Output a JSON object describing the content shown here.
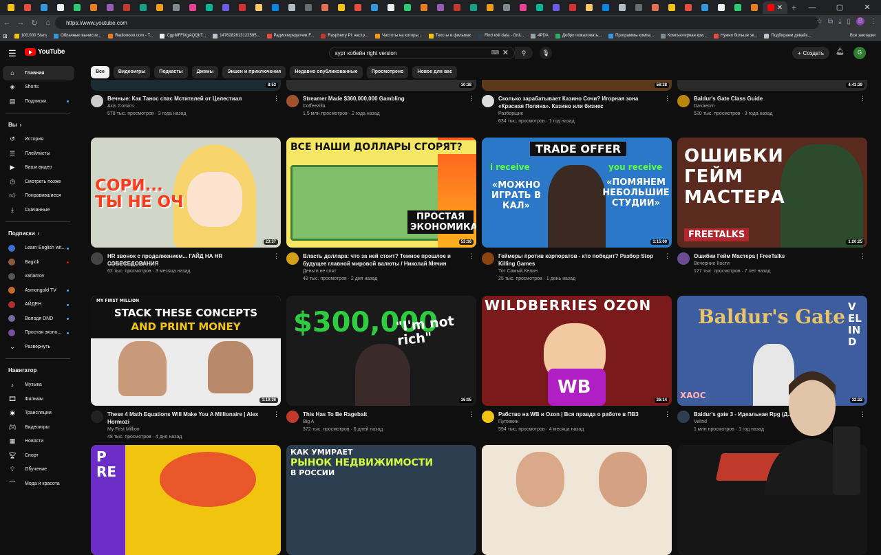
{
  "browser": {
    "url": "https://www.youtube.com",
    "bookmarks": [
      "100,000 Stars",
      "Облачные вычисле...",
      "Radiooooo.com - T...",
      "CgpMFFiXgAQQbT...",
      "1476282613122595...",
      "Радиопередатчик F...",
      "Raspberry Pi: настр...",
      "Частоты на которы...",
      "Тексты в фильмах",
      "Find exif data - Onli...",
      "4PDA",
      "Добро пожаловать...",
      "Программы компа...",
      "Компьютерная кри...",
      "Нужно больше эк...",
      "Подбираем девайс..."
    ],
    "bookmarks_right": "Все закладки"
  },
  "header": {
    "brand": "YouTube",
    "search_query": "курт кобейн right version",
    "create_label": "Создать",
    "avatar_letter": "G"
  },
  "chips": [
    "Все",
    "Видеоигры",
    "Подкасты",
    "Джемы",
    "Экшен и приключения",
    "Недавно опубликованные",
    "Просмотрено",
    "Новое для вас"
  ],
  "sidebar": {
    "main": [
      {
        "label": "Главная",
        "icon": "home-icon"
      },
      {
        "label": "Shorts",
        "icon": "shorts-icon"
      },
      {
        "label": "Подписки",
        "icon": "subscriptions-icon"
      }
    ],
    "you_header": "Вы",
    "you": [
      {
        "label": "История",
        "icon": "history-icon"
      },
      {
        "label": "Плейлисты",
        "icon": "playlist-icon"
      },
      {
        "label": "Ваши видео",
        "icon": "video-icon"
      },
      {
        "label": "Смотреть позже",
        "icon": "clock-icon"
      },
      {
        "label": "Понравившиеся",
        "icon": "thumbs-up-icon"
      },
      {
        "label": "Скачанные",
        "icon": "download-icon"
      }
    ],
    "subs_header": "Подписки",
    "subs": [
      {
        "label": "Learn English wit...",
        "color": "#3b6fd4"
      },
      {
        "label": "Bagick",
        "color": "#8a5a3c"
      },
      {
        "label": "varlamov",
        "color": "#555555"
      },
      {
        "label": "Asmongold TV",
        "color": "#c4682d"
      },
      {
        "label": "АЙДЕН",
        "color": "#b03030"
      },
      {
        "label": "Володя DND",
        "color": "#6d6d9e"
      },
      {
        "label": "Простая эконо...",
        "color": "#7a4fa0"
      }
    ],
    "expand_label": "Развернуть",
    "nav_header": "Навигатор",
    "nav": [
      {
        "label": "Музыка",
        "icon": "music-icon"
      },
      {
        "label": "Фильмы",
        "icon": "film-icon"
      },
      {
        "label": "Трансляции",
        "icon": "live-icon"
      },
      {
        "label": "Видеоигры",
        "icon": "gamepad-icon"
      },
      {
        "label": "Новости",
        "icon": "news-icon"
      },
      {
        "label": "Спорт",
        "icon": "trophy-icon"
      },
      {
        "label": "Обучение",
        "icon": "bulb-icon"
      },
      {
        "label": "Мода и красота",
        "icon": "hanger-icon"
      }
    ]
  },
  "row0": [
    {
      "title": "Вечные: Как Танос спас Мстителей от Целестиал",
      "channel": "Axis Comics",
      "stats": "578 тыс. просмотров · 3 года назад",
      "duration": "8:53",
      "av": "#cccccc"
    },
    {
      "title": "Streamer Made $360,000,000 Gambling",
      "channel": "Coffeezilla",
      "stats": "1,5 млн просмотров · 2 года назад",
      "duration": "10:38",
      "av": "#a0522d"
    },
    {
      "title": "Сколько зарабатывает Казино Сочи? Игорная зона «Красная Поляна». Казино или бизнес",
      "channel": "Разборщик",
      "stats": "634 тыс. просмотров · 1 год назад",
      "duration": "56:28",
      "av": "#dddddd"
    },
    {
      "title": "Baldur's Gate Class Guide",
      "channel": "Davaeorn",
      "stats": "520 тыс. просмотров · 3 года назад",
      "duration": "4:43:39",
      "av": "#b8860b"
    }
  ],
  "row1": [
    {
      "title": "HR звонок с продолжением... ГАЙД НА HR СОБЕСЕДОВАНИЯ",
      "channel": "Одноглазый Змей",
      "stats": "62 тыс. просмотров · 3 месяца назад",
      "duration": "23:37",
      "av": "#444444",
      "thumb_text": "СОРИ... ТЫ НЕ ОЧ"
    },
    {
      "title": "Власть доллара: что за ней стоит? Темное прошлое и будущее главной мировой валюты / Николай Мячин",
      "channel": "Деньги не спят",
      "stats": "48 тыс. просмотров · 2 дня назад",
      "duration": "53:16",
      "av": "#d4a017",
      "thumb_text": "ВСЕ НАШИ ДОЛЛАРЫ СГОРЯТ?",
      "thumb_text2": "ПРОСТАЯ ЭКОНОМИКА"
    },
    {
      "title": "Геймеры против корпоратов - кто победит? Разбор Stop Killing Games",
      "channel": "Тот Самый Келин",
      "stats": "25 тыс. просмотров · 1 день назад",
      "duration": "1:15:00",
      "av": "#8b4513",
      "thumb_text": "TRADE OFFER",
      "thumb_text2": "i receive",
      "thumb_text3": "you receive",
      "thumb_text4": "«МОЖНО ИГРАТЬ В КАЛ»",
      "thumb_text5": "«ПОМЯНЕМ НЕБОЛЬШИЕ СТУДИИ»"
    },
    {
      "title": "Ошибки Гейм Мастера | FreeTalks",
      "channel": "Вечерние Кости",
      "stats": "127 тыс. просмотров · 7 лет назад",
      "duration": "1:20:25",
      "av": "#6a4c93",
      "thumb_text": "ОШИБКИ ГЕЙМ МАСТЕРА",
      "thumb_text2": "FREETALKS"
    }
  ],
  "row2": [
    {
      "title": "These 4 Math Equations Will Make You A Millionaire | Alex Hormozi",
      "channel": "My First Million",
      "stats": "48 тыс. просмотров · 4 дня назад",
      "duration": "1:19:36",
      "av": "#222222",
      "thumb_text": "STACK THESE CONCEPTS",
      "thumb_text2": "AND PRINT MONEY",
      "thumb_text3": "MY FIRST MILLION"
    },
    {
      "title": "This Has To Be Ragebait",
      "channel": "Big A",
      "stats": "372 тыс. просмотров · 6 дней назад",
      "duration": "16:05",
      "av": "#c0392b",
      "thumb_text": "$300,000",
      "thumb_text2": "\"I'm not rich\""
    },
    {
      "title": "Рабство на WB и Ozon | Вся правда о работе в ПВЗ",
      "channel": "Пуговкин",
      "stats": "594 тыс. просмотров · 4 месяца назад",
      "duration": "26:14",
      "av": "#f1c40f",
      "thumb_text": "WILDBERRIES OZON",
      "thumb_text2": "WB"
    },
    {
      "title": "Baldur's gate 3 - Идеальная Rpg (Д...",
      "channel": "Velind",
      "stats": "1 млн просмотров · 1 год назад",
      "duration": "32:22",
      "av": "#2c3e50",
      "thumb_text": "Baldur's Gate",
      "thumb_text2": "VELIND",
      "thumb_text3": "ХАОС"
    }
  ],
  "row3_thumbs": [
    {
      "thumb_text": "PRE"
    },
    {
      "thumb_text": "КАК УМИРАЕТ",
      "thumb_text2": "РЫНОК НЕДВИЖИМОСТИ",
      "thumb_text3": "В РОССИИ"
    },
    {},
    {}
  ]
}
